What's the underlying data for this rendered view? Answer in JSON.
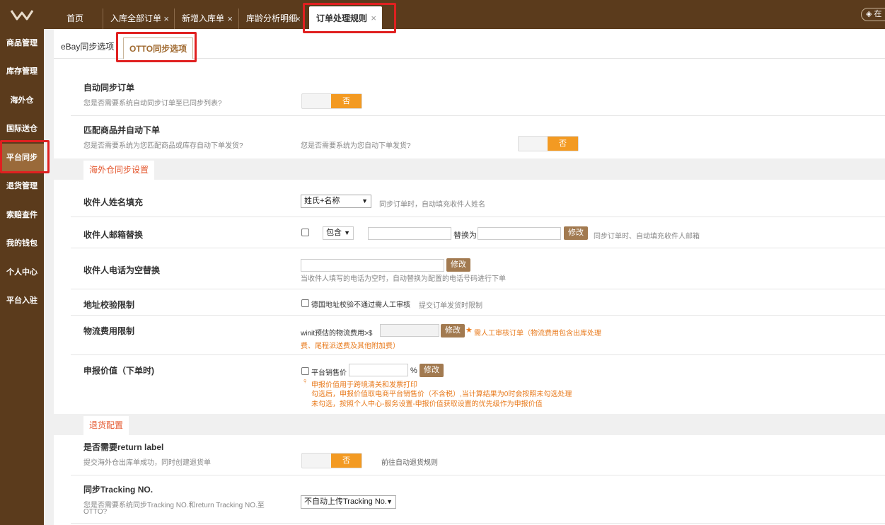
{
  "topbar": {
    "tabs": [
      {
        "label": "首页",
        "closable": false
      },
      {
        "label": "入库全部订单",
        "closable": true
      },
      {
        "label": "新增入库单",
        "closable": true
      },
      {
        "label": "库龄分析明细",
        "closable": true
      },
      {
        "label": "订单处理规则",
        "closable": true,
        "active": true
      }
    ],
    "close_glyph": "×",
    "right_button": "在"
  },
  "sidebar": {
    "items": [
      {
        "label": "商品管理"
      },
      {
        "label": "库存管理"
      },
      {
        "label": "海外仓"
      },
      {
        "label": "国际送仓"
      },
      {
        "label": "平台同步",
        "active": true
      },
      {
        "label": "退货管理"
      },
      {
        "label": "索赔查件"
      },
      {
        "label": "我的钱包"
      },
      {
        "label": "个人中心"
      },
      {
        "label": "平台入驻"
      }
    ]
  },
  "subtabs": [
    "eBay同步选项",
    "OTTO同步选项"
  ],
  "auto_sync": {
    "title": "自动同步订单",
    "desc": "您是否需要系统自动同步订单至已同步列表?",
    "toggle": "否"
  },
  "match_order": {
    "title": "匹配商品并自动下单",
    "desc": "您是否需要系统为您匹配商品或库存自动下单发货?",
    "desc2": "您是否需要系统为您自动下单发货?",
    "toggle": "否"
  },
  "overseas_section": "海外仓同步设置",
  "recipient_name": {
    "title": "收件人姓名填充",
    "select": "姓氏+名称",
    "hint": "同步订单时，自动填充收件人姓名"
  },
  "recipient_email": {
    "title": "收件人邮箱替换",
    "select": "包含",
    "replace_label": "替换为",
    "button": "修改",
    "hint": "同步订单时、自动填充收件人邮箱"
  },
  "recipient_phone": {
    "title": "收件人电话为空替换",
    "button": "修改",
    "hint": "当收件人填写的电话为空时，自动替换为配置的电话号码进行下单"
  },
  "address_check": {
    "title": "地址校验限制",
    "checkbox_label": "德国地址校验不通过需人工审核",
    "hint": "提交订单发货时限制"
  },
  "logistics_fee": {
    "title": "物流费用限制",
    "prefix": "winit预估的物流费用>$",
    "button": "修改",
    "star": "★",
    "note_line1": "需人工审核订单（物流费用包含出库处理",
    "note_line2": "费、尾程派送费及其他附加费）"
  },
  "declared_value": {
    "title": "申报价值（下单时)",
    "checkbox_label": "平台销售价",
    "percent": "%",
    "button": "修改",
    "bulb": "♀",
    "note_line1": "申报价值用于跨境清关和发票打印",
    "note_line2": "勾选后，申报价值取电商平台销售价（不含税）,当计算结果为0时会按照未勾选处理",
    "note_line3": "未勾选，按照个人中心-服务设置-申报价值获取设置的优先级作为申报价值"
  },
  "return_section": "退货配置",
  "return_label": {
    "title": "是否需要return label",
    "desc": "提交海外仓出库单成功，同时创建退货单",
    "toggle": "否",
    "link": "前往自动退货规则"
  },
  "sync_tracking": {
    "title": "同步Tracking NO.",
    "desc_line1": "您是否需要系统同步Tracking NO.和return Tracking NO.至",
    "desc_line2": "OTTO?",
    "select": "不自动上传Tracking No."
  },
  "colors": {
    "brand_brown": "#5b3b1c",
    "active_side": "#9a6a3a",
    "toggle_orange": "#f39a22",
    "button_brown": "#a27a50",
    "section_red": "#e4572e",
    "note_orange": "#e87a1c",
    "highlight_red": "#e02020"
  }
}
